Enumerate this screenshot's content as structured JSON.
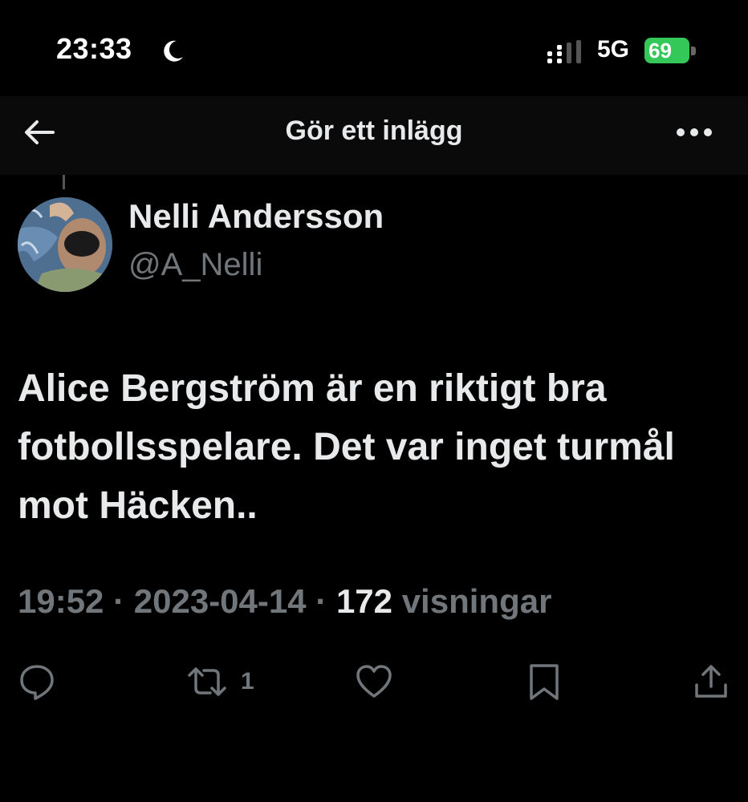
{
  "status_bar": {
    "time": "23:33",
    "network": "5G",
    "battery": "69"
  },
  "nav": {
    "title": "Gör ett inlägg"
  },
  "post": {
    "author_name": "Nelli Andersson",
    "author_handle": "@A_Nelli",
    "text": "Alice Bergström är en riktigt bra fotbollsspelare. Det var inget turmål mot Häcken..",
    "time": "19:52",
    "separator": "·",
    "date": "2023-04-14",
    "views_count": "172",
    "views_label": "visningar",
    "retweet_count": "1"
  },
  "colors": {
    "background": "#000000",
    "text_primary": "#e7e9ea",
    "text_secondary": "#71767b",
    "battery_green": "#34c759"
  },
  "icons": {
    "back": "arrow-left-icon",
    "more": "more-horizontal-icon",
    "reply": "reply-icon",
    "retweet": "retweet-icon",
    "like": "heart-icon",
    "bookmark": "bookmark-icon",
    "share": "share-icon"
  }
}
